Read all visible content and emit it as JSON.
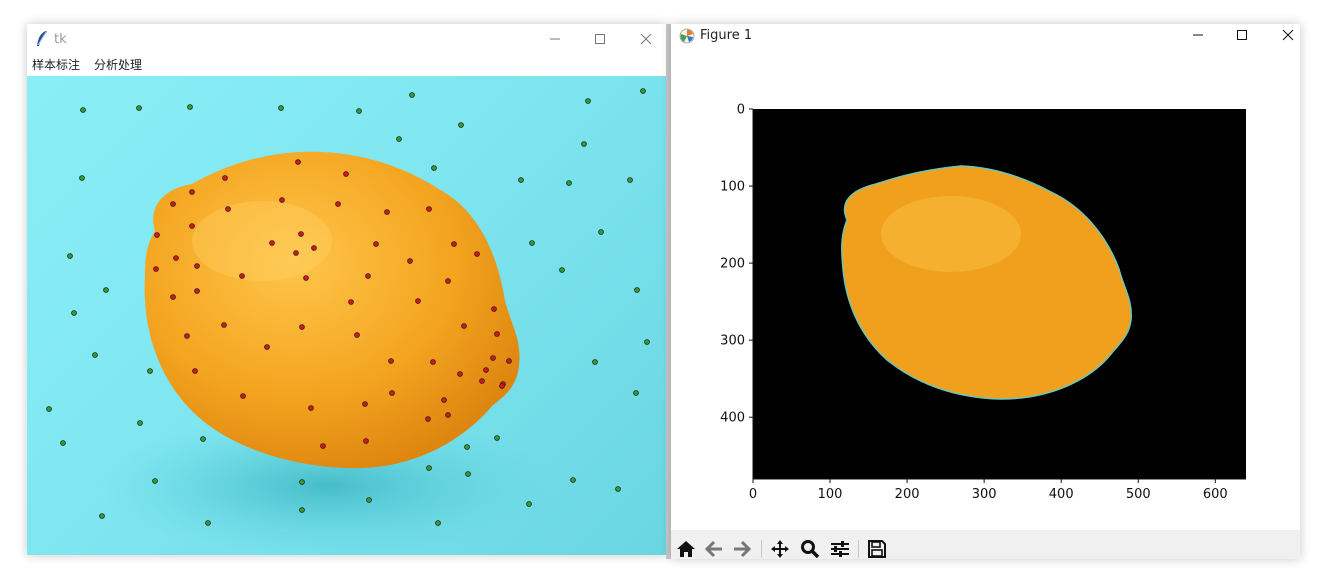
{
  "tk_window": {
    "title": "tk",
    "menu": [
      {
        "label": "样本标注"
      },
      {
        "label": "分析处理"
      }
    ]
  },
  "figure_window": {
    "title": "Figure 1",
    "x_ticks": [
      "0",
      "100",
      "200",
      "300",
      "400",
      "500",
      "600"
    ],
    "y_ticks": [
      "0",
      "100",
      "200",
      "300",
      "400"
    ],
    "toolbar": [
      "home-icon",
      "back-icon",
      "forward-icon",
      "pan-icon",
      "zoom-icon",
      "configure-subplots-icon",
      "save-icon"
    ]
  },
  "annotations": {
    "foreground_color": "#e0121b",
    "background_color": "#2f9e33"
  },
  "colors": {
    "cyan_background": "#86e9f2",
    "lemon": "#f2a51c",
    "mask_background": "#000000"
  }
}
